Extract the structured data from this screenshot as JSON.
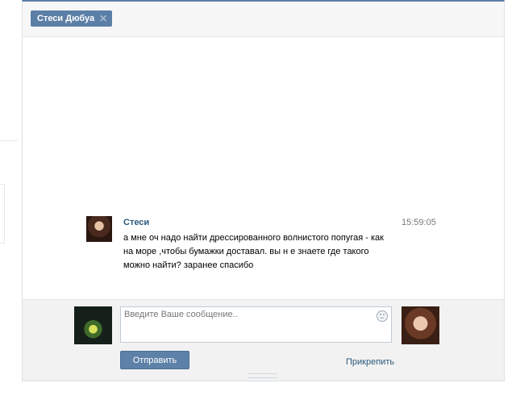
{
  "tab": {
    "name": "Стеси Дюбуа",
    "close": "✕"
  },
  "message": {
    "author": "Стеси",
    "time": "15:59:05",
    "text": "а мне оч надо найти дрессированного волнистого попугая - как на море ,чтобы бумажки доставал. вы н е знаете где такого можно найти? заранее спасибо"
  },
  "composer": {
    "placeholder": "Введите Ваше сообщение..",
    "value": "",
    "send_label": "Отправить",
    "attach_label": "Прикрепить"
  },
  "icons": {
    "emoji": "smile-icon",
    "tab_close": "close-icon"
  },
  "colors": {
    "accent": "#5b7fa6",
    "link": "#2b587a",
    "composer_bg": "#f2f2f2"
  }
}
